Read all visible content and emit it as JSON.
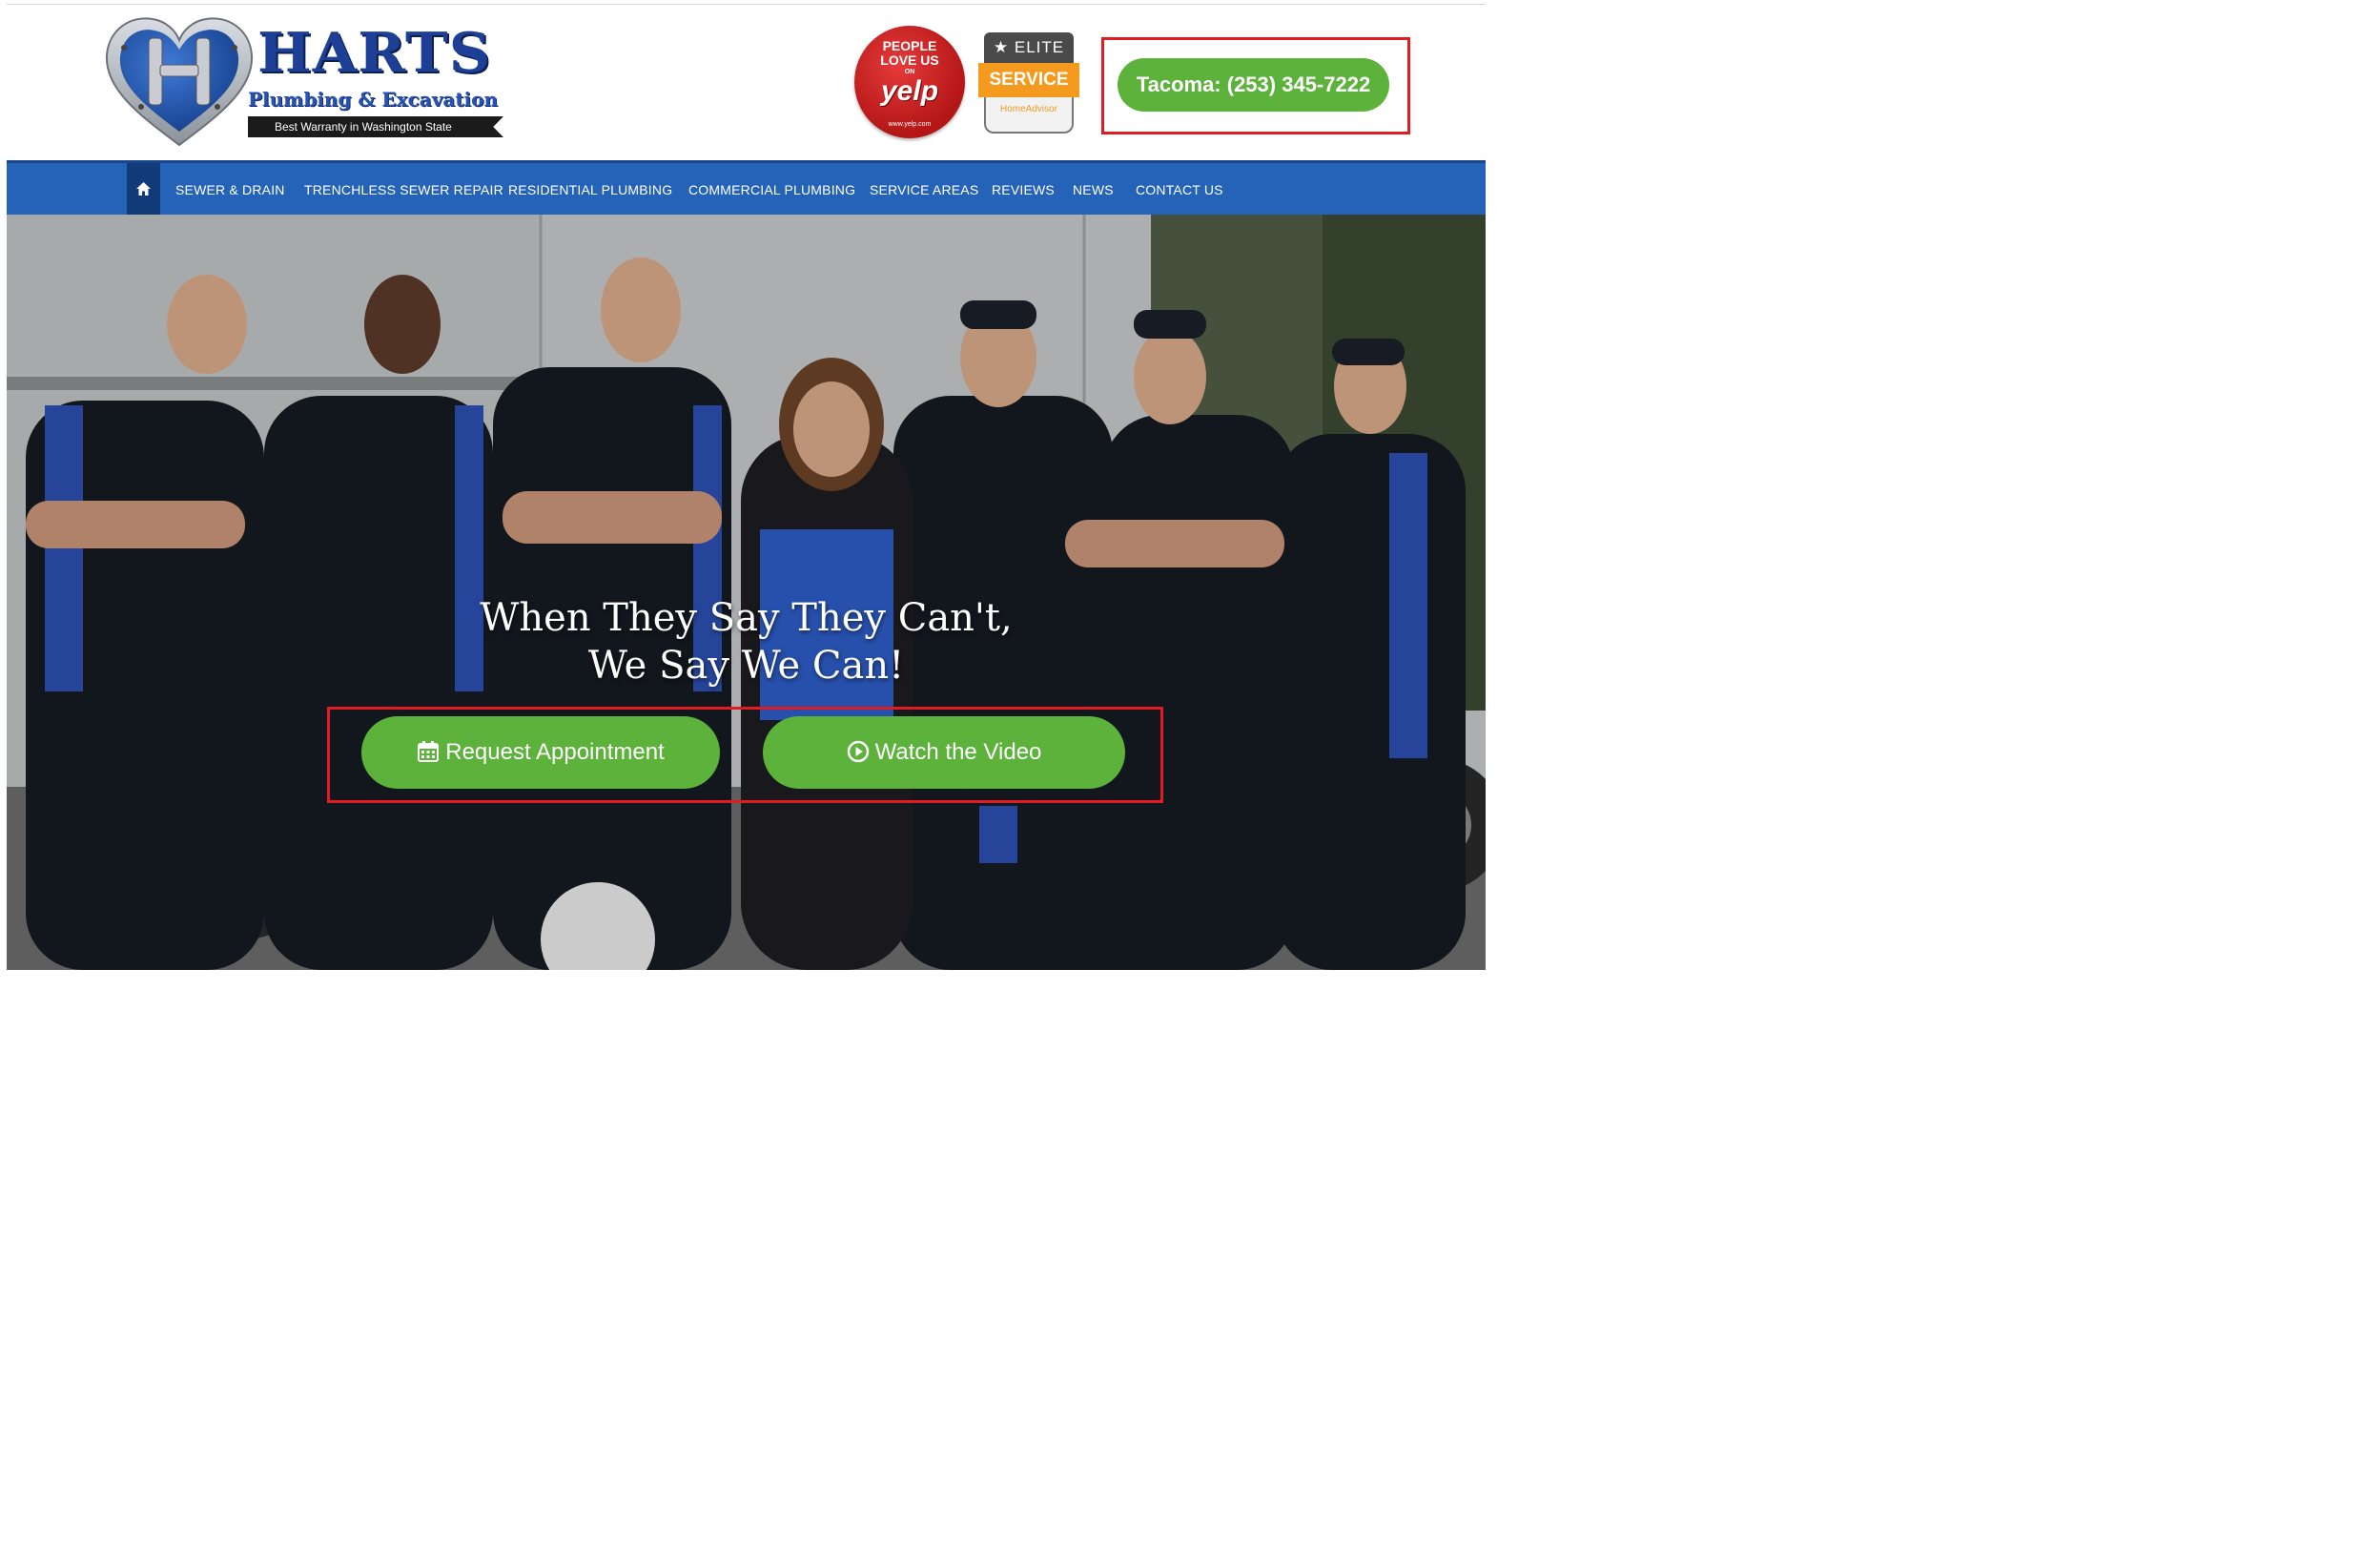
{
  "header": {
    "logo": {
      "title": "HARTS",
      "subtitle": "Plumbing & Excavation",
      "tagline": "Best Warranty in Washington State"
    },
    "badges": {
      "yelp": {
        "line1": "PEOPLE",
        "line2": "LOVE US",
        "on": "ON",
        "brand": "yelp",
        "url": "www.yelp.com"
      },
      "elite": {
        "top": "ELITE",
        "middle": "SERVICE",
        "bottom": "HomeAdvisor"
      }
    },
    "phone_button": "Tacoma: (253) 345-7222"
  },
  "nav": {
    "items": [
      "SEWER & DRAIN",
      "TRENCHLESS SEWER REPAIR",
      "RESIDENTIAL PLUMBING",
      "COMMERCIAL PLUMBING",
      "SERVICE AREAS",
      "REVIEWS",
      "NEWS",
      "CONTACT US"
    ]
  },
  "hero": {
    "headline_line1": "When They Say They Can't,",
    "headline_line2": "We Say We Can!",
    "cta_appointment": "Request Appointment",
    "cta_video": "Watch the Video"
  },
  "colors": {
    "nav_blue": "#2563b8",
    "nav_home_dark": "#113a78",
    "cta_green": "#5cb23a",
    "highlight_red": "#e11b22",
    "logo_blue": "#1d3f96"
  },
  "icons": [
    "home-icon",
    "calendar-icon",
    "play-circle-icon",
    "heart-logo-icon"
  ]
}
